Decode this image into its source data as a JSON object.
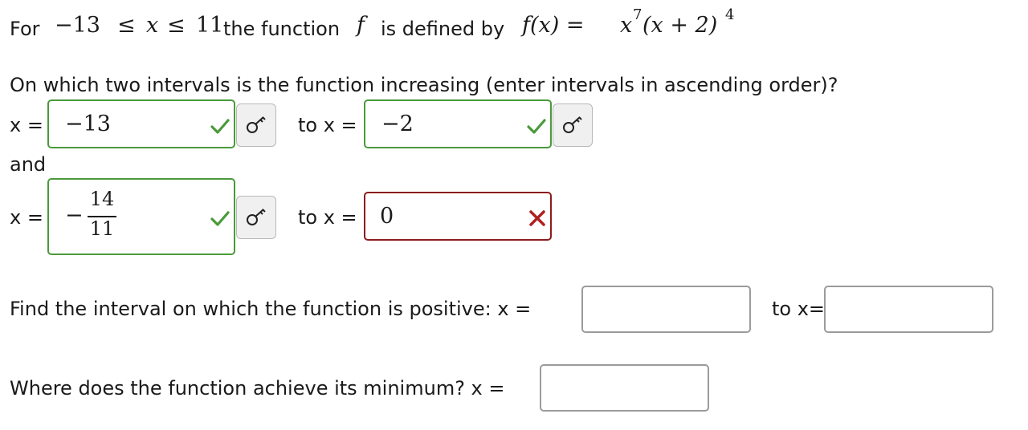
{
  "intro": {
    "prefix": "For",
    "range_low": "−13",
    "leq1": "≤",
    "var_x": "x",
    "leq2": "≤",
    "range_high": "11",
    "mid_text": "the function",
    "fname": "f",
    "mid_text2": "is defined by",
    "formula_lhs": "f(x) =",
    "formula_x": "x",
    "exp7": "7",
    "formula_paren": "(x + 2)",
    "exp4": "4"
  },
  "q1": {
    "prompt": "On which two intervals is the function increasing (enter intervals in ascending order)?",
    "row1": {
      "x_label": "x =",
      "from_value": "−13",
      "to_label": "to x =",
      "to_value": "−2"
    },
    "and_label": "and",
    "row2": {
      "x_label": "x =",
      "from_sign": "−",
      "from_num": "14",
      "from_den": "11",
      "to_label": "to x =",
      "to_value": "0"
    }
  },
  "q2": {
    "prompt": "Find the interval on which the function is positive: x =",
    "to_label": "to x=",
    "from_value": "",
    "to_value": ""
  },
  "q3": {
    "prompt": "Where does the function achieve its minimum? x =",
    "value": ""
  },
  "colors": {
    "correct": "#4a9a3a",
    "incorrect": "#8b1c1c",
    "neutral_border": "#9b9b9b"
  }
}
